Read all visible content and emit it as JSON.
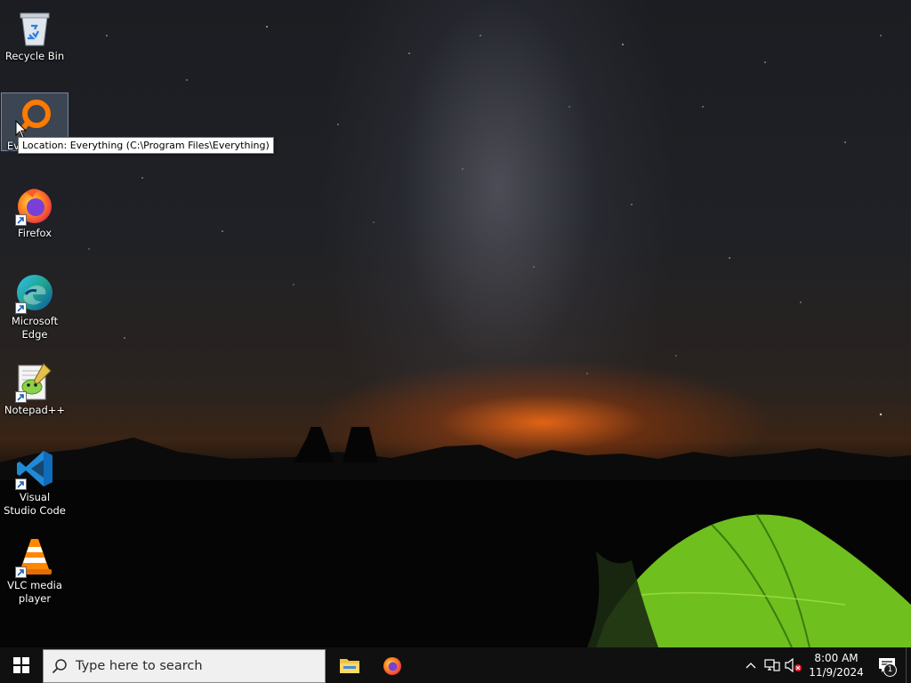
{
  "desktop_icons": [
    {
      "label": "Recycle Bin"
    },
    {
      "label": "Everything"
    },
    {
      "label": "Firefox"
    },
    {
      "label": "Microsoft Edge"
    },
    {
      "label": "Notepad++"
    },
    {
      "label": "Visual Studio Code"
    },
    {
      "label": "VLC media player"
    }
  ],
  "tooltip": {
    "text": "Location: Everything (C:\\Program Files\\Everything)"
  },
  "taskbar": {
    "search_placeholder": "Type here to search",
    "apps": [
      "File Explorer",
      "Firefox"
    ],
    "clock_time": "8:00 AM",
    "clock_date": "11/9/2024",
    "notification_count": "1"
  },
  "colors": {
    "taskbar": "#101010",
    "selection": "#788caa",
    "tent_green": "#7ed321"
  }
}
